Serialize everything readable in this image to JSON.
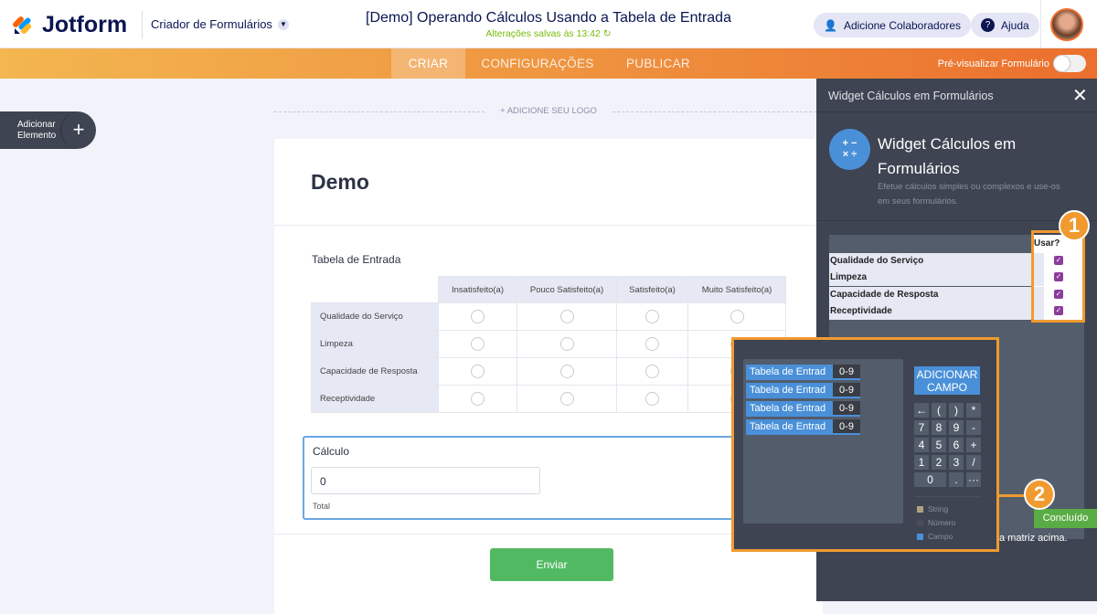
{
  "header": {
    "brand": "Jotform",
    "builder": "Criador de Formulários",
    "title": "[Demo] Operando Cálculos Usando a Tabela de Entrada",
    "saved": "Alterações salvas às 13:42",
    "collaborators": "Adicione Colaboradores",
    "help": "Ajuda"
  },
  "nav": {
    "tabs": [
      "CRIAR",
      "CONFIGURAÇÕES",
      "PUBLICAR"
    ],
    "active": "CRIAR",
    "preview": "Pré-visualizar Formulário"
  },
  "sidebar": {
    "add_line1": "Adicionar",
    "add_line2": "Elemento"
  },
  "form": {
    "add_logo": "+ ADICIONE SEU LOGO",
    "heading": "Demo",
    "table_label": "Tabela de Entrada",
    "columns": [
      "Insatisfeito(a)",
      "Pouco Satisfeito(a)",
      "Satisfeito(a)",
      "Muito Satisfeito(a)"
    ],
    "rows": [
      "Qualidade do Serviço",
      "Limpeza",
      "Capacidade de Resposta",
      "Receptividade"
    ],
    "calc_label": "Cálculo",
    "calc_value": "0",
    "calc_sub": "Total",
    "submit": "Enviar"
  },
  "panel": {
    "header": "Widget Cálculos em Formulários",
    "title_line1": "Widget Cálculos em",
    "title_line2": "Formulários",
    "desc_line1": "Efetue cálculos simples ou complexos e use-os",
    "desc_line2": "em seus formulários.",
    "use_header": "Usar?",
    "use_rows": [
      "Qualidade do Serviço",
      "Limpeza",
      "Capacidade de Resposta",
      "Receptividade"
    ],
    "badge1": "1",
    "badge2": "2",
    "done": "Concluído",
    "footer_text": "a matriz acima."
  },
  "calc_editor": {
    "fields": [
      {
        "name": "Tabela de Entrad",
        "type": "0-9"
      },
      {
        "name": "Tabela de Entrad",
        "type": "0-9"
      },
      {
        "name": "Tabela de Entrad",
        "type": "0-9"
      },
      {
        "name": "Tabela de Entrad",
        "type": "0-9"
      }
    ],
    "add_field_line1": "ADICIONAR",
    "add_field_line2": "CAMPO",
    "keys": [
      "←",
      "(",
      ")",
      "*",
      "7",
      "8",
      "9",
      "-",
      "4",
      "5",
      "6",
      "+",
      "1",
      "2",
      "3",
      "/",
      "0",
      ".",
      "···"
    ],
    "legend": [
      "String",
      "Número",
      "Campo"
    ]
  },
  "colors": {
    "accent": "#f09a2f",
    "green": "#52b963",
    "blue": "#4a90d9",
    "panel": "#3e4452"
  }
}
